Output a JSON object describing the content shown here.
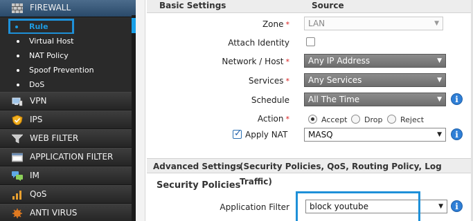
{
  "sidebar": {
    "firewall": {
      "label": "FIREWALL",
      "icon": "firewall-icon"
    },
    "sub_items": [
      {
        "label": "Rule",
        "selected": true
      },
      {
        "label": "Virtual Host"
      },
      {
        "label": "NAT Policy"
      },
      {
        "label": "Spoof Prevention"
      },
      {
        "label": "DoS"
      }
    ],
    "menu": [
      {
        "label": "VPN",
        "icon": "vpn-icon"
      },
      {
        "label": "IPS",
        "icon": "ips-shield-icon"
      },
      {
        "label": "WEB FILTER",
        "icon": "web-filter-icon"
      },
      {
        "label": "APPLICATION FILTER",
        "icon": "application-filter-icon"
      },
      {
        "label": "IM",
        "icon": "im-chat-icon"
      },
      {
        "label": "QoS",
        "icon": "qos-icon"
      },
      {
        "label": "ANTI VIRUS",
        "icon": "anti-virus-icon"
      }
    ],
    "accent_color": "#1e90d8"
  },
  "basic": {
    "header_left": "Basic Settings",
    "header_right": "Source",
    "zone": {
      "label": "Zone",
      "value": "LAN"
    },
    "attach_identity": {
      "label": "Attach Identity",
      "checked": false
    },
    "network_host": {
      "label": "Network / Host",
      "value": "Any IP Address"
    },
    "services": {
      "label": "Services",
      "value": "Any Services"
    },
    "schedule": {
      "label": "Schedule",
      "value": "All The Time"
    },
    "action": {
      "label": "Action",
      "options": [
        "Accept",
        "Drop",
        "Reject"
      ],
      "selected": "Accept"
    },
    "apply_nat": {
      "label": "Apply NAT",
      "checked": true,
      "value": "MASQ"
    }
  },
  "advanced": {
    "header": "Advanced Settings",
    "header_detail": "(Security Policies, QoS, Routing Policy, Log Traffic)",
    "security_policies": "Security Policies",
    "application_filter": {
      "label": "Application Filter",
      "value": "block youtube"
    }
  },
  "required_marker": "*"
}
